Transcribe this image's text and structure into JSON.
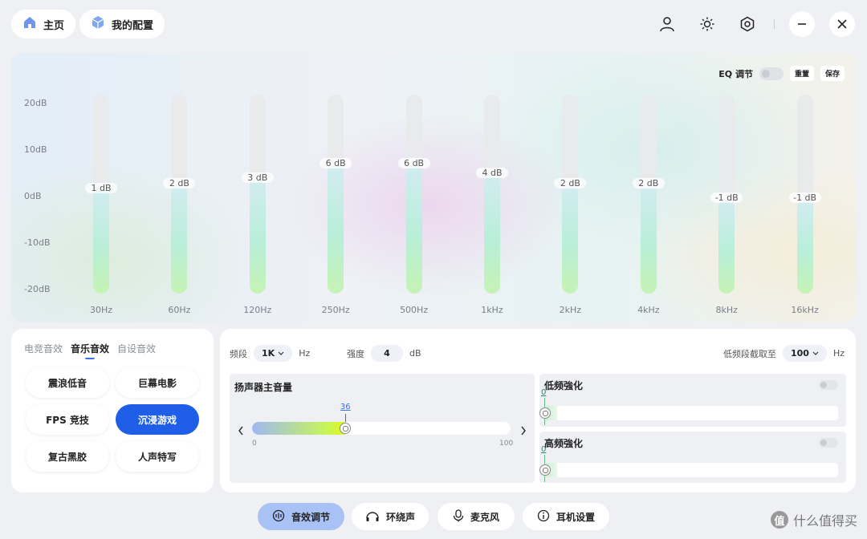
{
  "header": {
    "home_label": "主页",
    "config_label": "我的配置"
  },
  "eq": {
    "toggle_label": "EQ 调节",
    "reset_label": "重置",
    "save_label": "保存",
    "db_scale": [
      "20dB",
      "10dB",
      "0dB",
      "-10dB",
      "-20dB"
    ],
    "range": [
      -20,
      20
    ],
    "bands": [
      {
        "freq": "30Hz",
        "value": 1,
        "label": "1 dB"
      },
      {
        "freq": "60Hz",
        "value": 2,
        "label": "2 dB"
      },
      {
        "freq": "120Hz",
        "value": 3,
        "label": "3 dB"
      },
      {
        "freq": "250Hz",
        "value": 6,
        "label": "6 dB"
      },
      {
        "freq": "500Hz",
        "value": 6,
        "label": "6 dB"
      },
      {
        "freq": "1kHz",
        "value": 4,
        "label": "4 dB"
      },
      {
        "freq": "2kHz",
        "value": 2,
        "label": "2 dB"
      },
      {
        "freq": "4kHz",
        "value": 2,
        "label": "2 dB"
      },
      {
        "freq": "8kHz",
        "value": -1,
        "label": "-1 dB"
      },
      {
        "freq": "16kHz",
        "value": -1,
        "label": "-1 dB"
      }
    ]
  },
  "presets": {
    "tabs": [
      "电竞音效",
      "音乐音效",
      "自设音效"
    ],
    "active_tab": "音乐音效",
    "items": [
      "震浪低音",
      "巨幕电影",
      "FPS 竞技",
      "沉浸游戏",
      "复古黑胶",
      "人声特写"
    ],
    "selected": "沉浸游戏"
  },
  "controls": {
    "band_label": "频段",
    "band_value": "1K",
    "band_unit": "Hz",
    "gain_label": "强度",
    "gain_value": "4",
    "gain_unit": "dB",
    "cutoff_label": "低频段截取至",
    "cutoff_value": "100",
    "cutoff_unit": "Hz",
    "volume": {
      "title": "扬声器主音量",
      "value": 36,
      "value_text": "36",
      "min": "0",
      "max": "100"
    },
    "bass": {
      "title": "低频強化",
      "value_text": "0"
    },
    "treble": {
      "title": "高频強化",
      "value_text": "0"
    }
  },
  "nav": {
    "items": [
      "音效调节",
      "环绕声",
      "麦克风",
      "耳机设置"
    ],
    "selected": "音效调节"
  },
  "watermark": {
    "badge": "值",
    "text": "什么值得买"
  },
  "colors": {
    "accent": "#1f5ee6",
    "nav_selected": "#a9c2f6"
  }
}
